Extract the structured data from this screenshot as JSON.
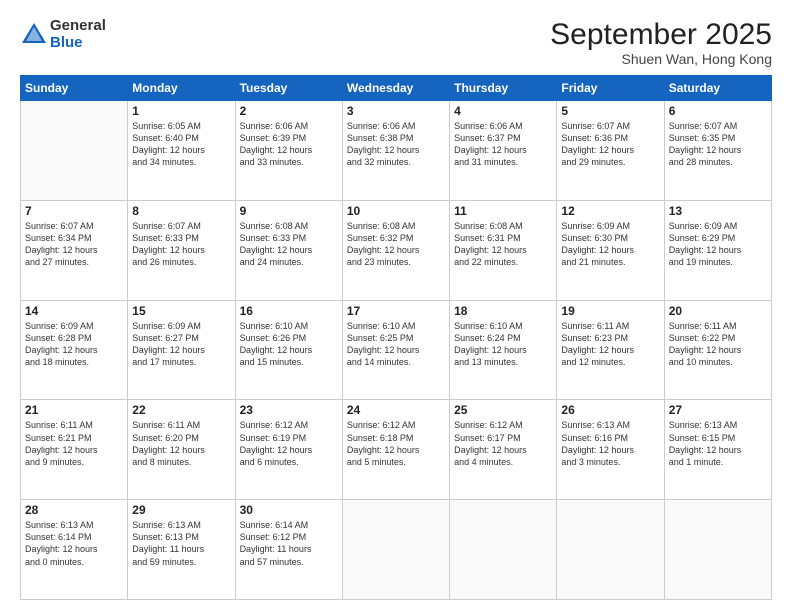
{
  "logo": {
    "general": "General",
    "blue": "Blue"
  },
  "header": {
    "month": "September 2025",
    "location": "Shuen Wan, Hong Kong"
  },
  "weekdays": [
    "Sunday",
    "Monday",
    "Tuesday",
    "Wednesday",
    "Thursday",
    "Friday",
    "Saturday"
  ],
  "weeks": [
    [
      {
        "day": "",
        "info": ""
      },
      {
        "day": "1",
        "info": "Sunrise: 6:05 AM\nSunset: 6:40 PM\nDaylight: 12 hours\nand 34 minutes."
      },
      {
        "day": "2",
        "info": "Sunrise: 6:06 AM\nSunset: 6:39 PM\nDaylight: 12 hours\nand 33 minutes."
      },
      {
        "day": "3",
        "info": "Sunrise: 6:06 AM\nSunset: 6:38 PM\nDaylight: 12 hours\nand 32 minutes."
      },
      {
        "day": "4",
        "info": "Sunrise: 6:06 AM\nSunset: 6:37 PM\nDaylight: 12 hours\nand 31 minutes."
      },
      {
        "day": "5",
        "info": "Sunrise: 6:07 AM\nSunset: 6:36 PM\nDaylight: 12 hours\nand 29 minutes."
      },
      {
        "day": "6",
        "info": "Sunrise: 6:07 AM\nSunset: 6:35 PM\nDaylight: 12 hours\nand 28 minutes."
      }
    ],
    [
      {
        "day": "7",
        "info": "Sunrise: 6:07 AM\nSunset: 6:34 PM\nDaylight: 12 hours\nand 27 minutes."
      },
      {
        "day": "8",
        "info": "Sunrise: 6:07 AM\nSunset: 6:33 PM\nDaylight: 12 hours\nand 26 minutes."
      },
      {
        "day": "9",
        "info": "Sunrise: 6:08 AM\nSunset: 6:33 PM\nDaylight: 12 hours\nand 24 minutes."
      },
      {
        "day": "10",
        "info": "Sunrise: 6:08 AM\nSunset: 6:32 PM\nDaylight: 12 hours\nand 23 minutes."
      },
      {
        "day": "11",
        "info": "Sunrise: 6:08 AM\nSunset: 6:31 PM\nDaylight: 12 hours\nand 22 minutes."
      },
      {
        "day": "12",
        "info": "Sunrise: 6:09 AM\nSunset: 6:30 PM\nDaylight: 12 hours\nand 21 minutes."
      },
      {
        "day": "13",
        "info": "Sunrise: 6:09 AM\nSunset: 6:29 PM\nDaylight: 12 hours\nand 19 minutes."
      }
    ],
    [
      {
        "day": "14",
        "info": "Sunrise: 6:09 AM\nSunset: 6:28 PM\nDaylight: 12 hours\nand 18 minutes."
      },
      {
        "day": "15",
        "info": "Sunrise: 6:09 AM\nSunset: 6:27 PM\nDaylight: 12 hours\nand 17 minutes."
      },
      {
        "day": "16",
        "info": "Sunrise: 6:10 AM\nSunset: 6:26 PM\nDaylight: 12 hours\nand 15 minutes."
      },
      {
        "day": "17",
        "info": "Sunrise: 6:10 AM\nSunset: 6:25 PM\nDaylight: 12 hours\nand 14 minutes."
      },
      {
        "day": "18",
        "info": "Sunrise: 6:10 AM\nSunset: 6:24 PM\nDaylight: 12 hours\nand 13 minutes."
      },
      {
        "day": "19",
        "info": "Sunrise: 6:11 AM\nSunset: 6:23 PM\nDaylight: 12 hours\nand 12 minutes."
      },
      {
        "day": "20",
        "info": "Sunrise: 6:11 AM\nSunset: 6:22 PM\nDaylight: 12 hours\nand 10 minutes."
      }
    ],
    [
      {
        "day": "21",
        "info": "Sunrise: 6:11 AM\nSunset: 6:21 PM\nDaylight: 12 hours\nand 9 minutes."
      },
      {
        "day": "22",
        "info": "Sunrise: 6:11 AM\nSunset: 6:20 PM\nDaylight: 12 hours\nand 8 minutes."
      },
      {
        "day": "23",
        "info": "Sunrise: 6:12 AM\nSunset: 6:19 PM\nDaylight: 12 hours\nand 6 minutes."
      },
      {
        "day": "24",
        "info": "Sunrise: 6:12 AM\nSunset: 6:18 PM\nDaylight: 12 hours\nand 5 minutes."
      },
      {
        "day": "25",
        "info": "Sunrise: 6:12 AM\nSunset: 6:17 PM\nDaylight: 12 hours\nand 4 minutes."
      },
      {
        "day": "26",
        "info": "Sunrise: 6:13 AM\nSunset: 6:16 PM\nDaylight: 12 hours\nand 3 minutes."
      },
      {
        "day": "27",
        "info": "Sunrise: 6:13 AM\nSunset: 6:15 PM\nDaylight: 12 hours\nand 1 minute."
      }
    ],
    [
      {
        "day": "28",
        "info": "Sunrise: 6:13 AM\nSunset: 6:14 PM\nDaylight: 12 hours\nand 0 minutes."
      },
      {
        "day": "29",
        "info": "Sunrise: 6:13 AM\nSunset: 6:13 PM\nDaylight: 11 hours\nand 59 minutes."
      },
      {
        "day": "30",
        "info": "Sunrise: 6:14 AM\nSunset: 6:12 PM\nDaylight: 11 hours\nand 57 minutes."
      },
      {
        "day": "",
        "info": ""
      },
      {
        "day": "",
        "info": ""
      },
      {
        "day": "",
        "info": ""
      },
      {
        "day": "",
        "info": ""
      }
    ]
  ]
}
